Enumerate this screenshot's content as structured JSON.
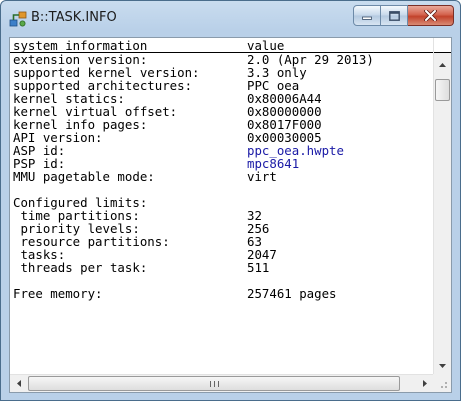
{
  "window": {
    "title": "B::TASK.INFO"
  },
  "table": {
    "col_label": "system information",
    "col_value": "value",
    "rows": [
      {
        "label": "extension version:",
        "value": "2.0 (Apr 29 2013)"
      },
      {
        "label": "supported kernel version:",
        "value": "3.3 only"
      },
      {
        "label": "supported architectures:",
        "value": "PPC oea"
      },
      {
        "label": "kernel statics:",
        "value": "0x80006A44"
      },
      {
        "label": "kernel virtual offset:",
        "value": "0x80000000"
      },
      {
        "label": "kernel info pages:",
        "value": "0x8017F000"
      },
      {
        "label": "API version:",
        "value": "0x00030005"
      },
      {
        "label": "ASP id:",
        "value": "ppc_oea.hwpte"
      },
      {
        "label": "PSP id:",
        "value": "mpc8641"
      },
      {
        "label": "MMU pagetable mode:",
        "value": "virt"
      },
      {
        "label": "Configured limits:",
        "value": ""
      },
      {
        "label": " time partitions:",
        "value": "32"
      },
      {
        "label": " priority levels:",
        "value": "256"
      },
      {
        "label": " resource partitions:",
        "value": "63"
      },
      {
        "label": " tasks:",
        "value": "2047"
      },
      {
        "label": " threads per task:",
        "value": "511"
      },
      {
        "label": "Free memory:",
        "value": "257461 pages"
      }
    ]
  },
  "colors": {
    "link": "#1a1aa6",
    "close": "#c2422b"
  },
  "icons": [
    "app-icon",
    "minimize-icon",
    "maximize-icon",
    "close-icon",
    "scroll-up-icon",
    "scroll-down-icon",
    "scroll-left-icon",
    "scroll-right-icon",
    "size-grip-icon"
  ]
}
